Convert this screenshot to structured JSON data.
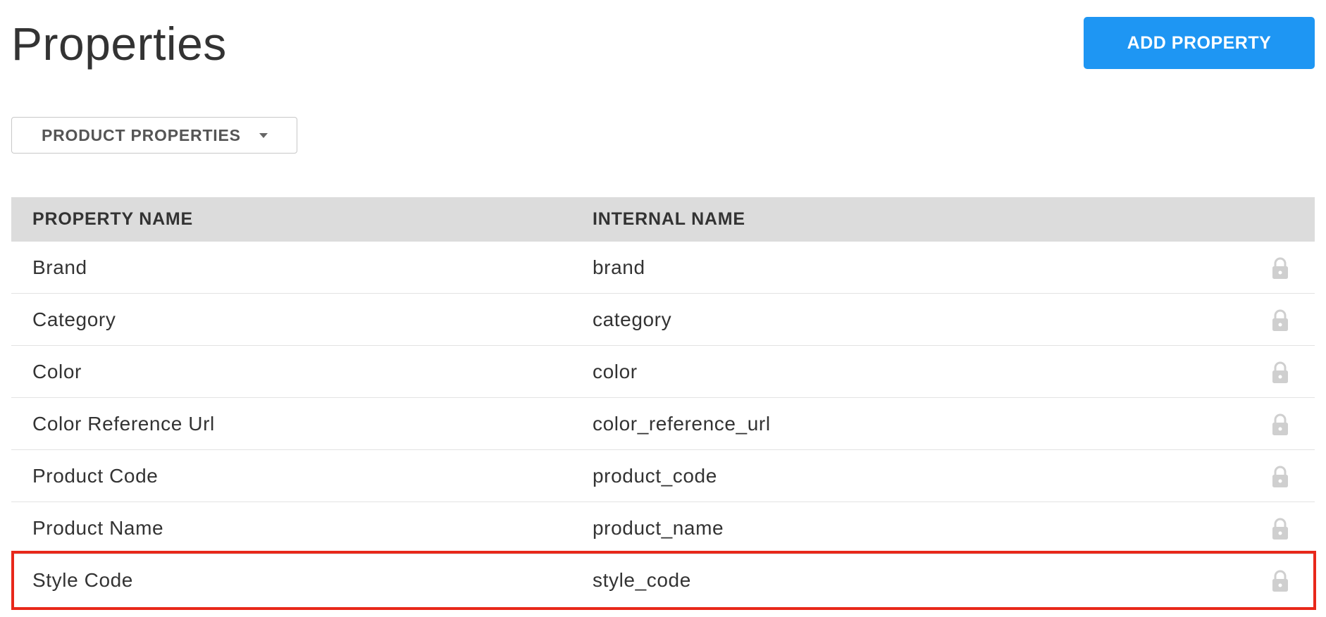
{
  "page": {
    "title": "Properties"
  },
  "toolbar": {
    "add_button_label": "ADD PROPERTY",
    "accent_color": "#1e96f3"
  },
  "filter": {
    "selected_label": "PRODUCT PROPERTIES",
    "icon": "caret-down-icon"
  },
  "table": {
    "headers": {
      "property_name": "PROPERTY NAME",
      "internal_name": "INTERNAL NAME"
    },
    "rows": [
      {
        "property_name": "Brand",
        "internal_name": "brand",
        "icon": "lock-icon"
      },
      {
        "property_name": "Category",
        "internal_name": "category",
        "icon": "lock-icon"
      },
      {
        "property_name": "Color",
        "internal_name": "color",
        "icon": "lock-icon"
      },
      {
        "property_name": "Color Reference Url",
        "internal_name": "color_reference_url",
        "icon": "lock-icon"
      },
      {
        "property_name": "Product Code",
        "internal_name": "product_code",
        "icon": "lock-icon"
      },
      {
        "property_name": "Product Name",
        "internal_name": "product_name",
        "icon": "lock-icon"
      },
      {
        "property_name": "Style Code",
        "internal_name": "style_code",
        "icon": "lock-icon"
      }
    ]
  },
  "highlight": {
    "color": "#e8281a"
  }
}
